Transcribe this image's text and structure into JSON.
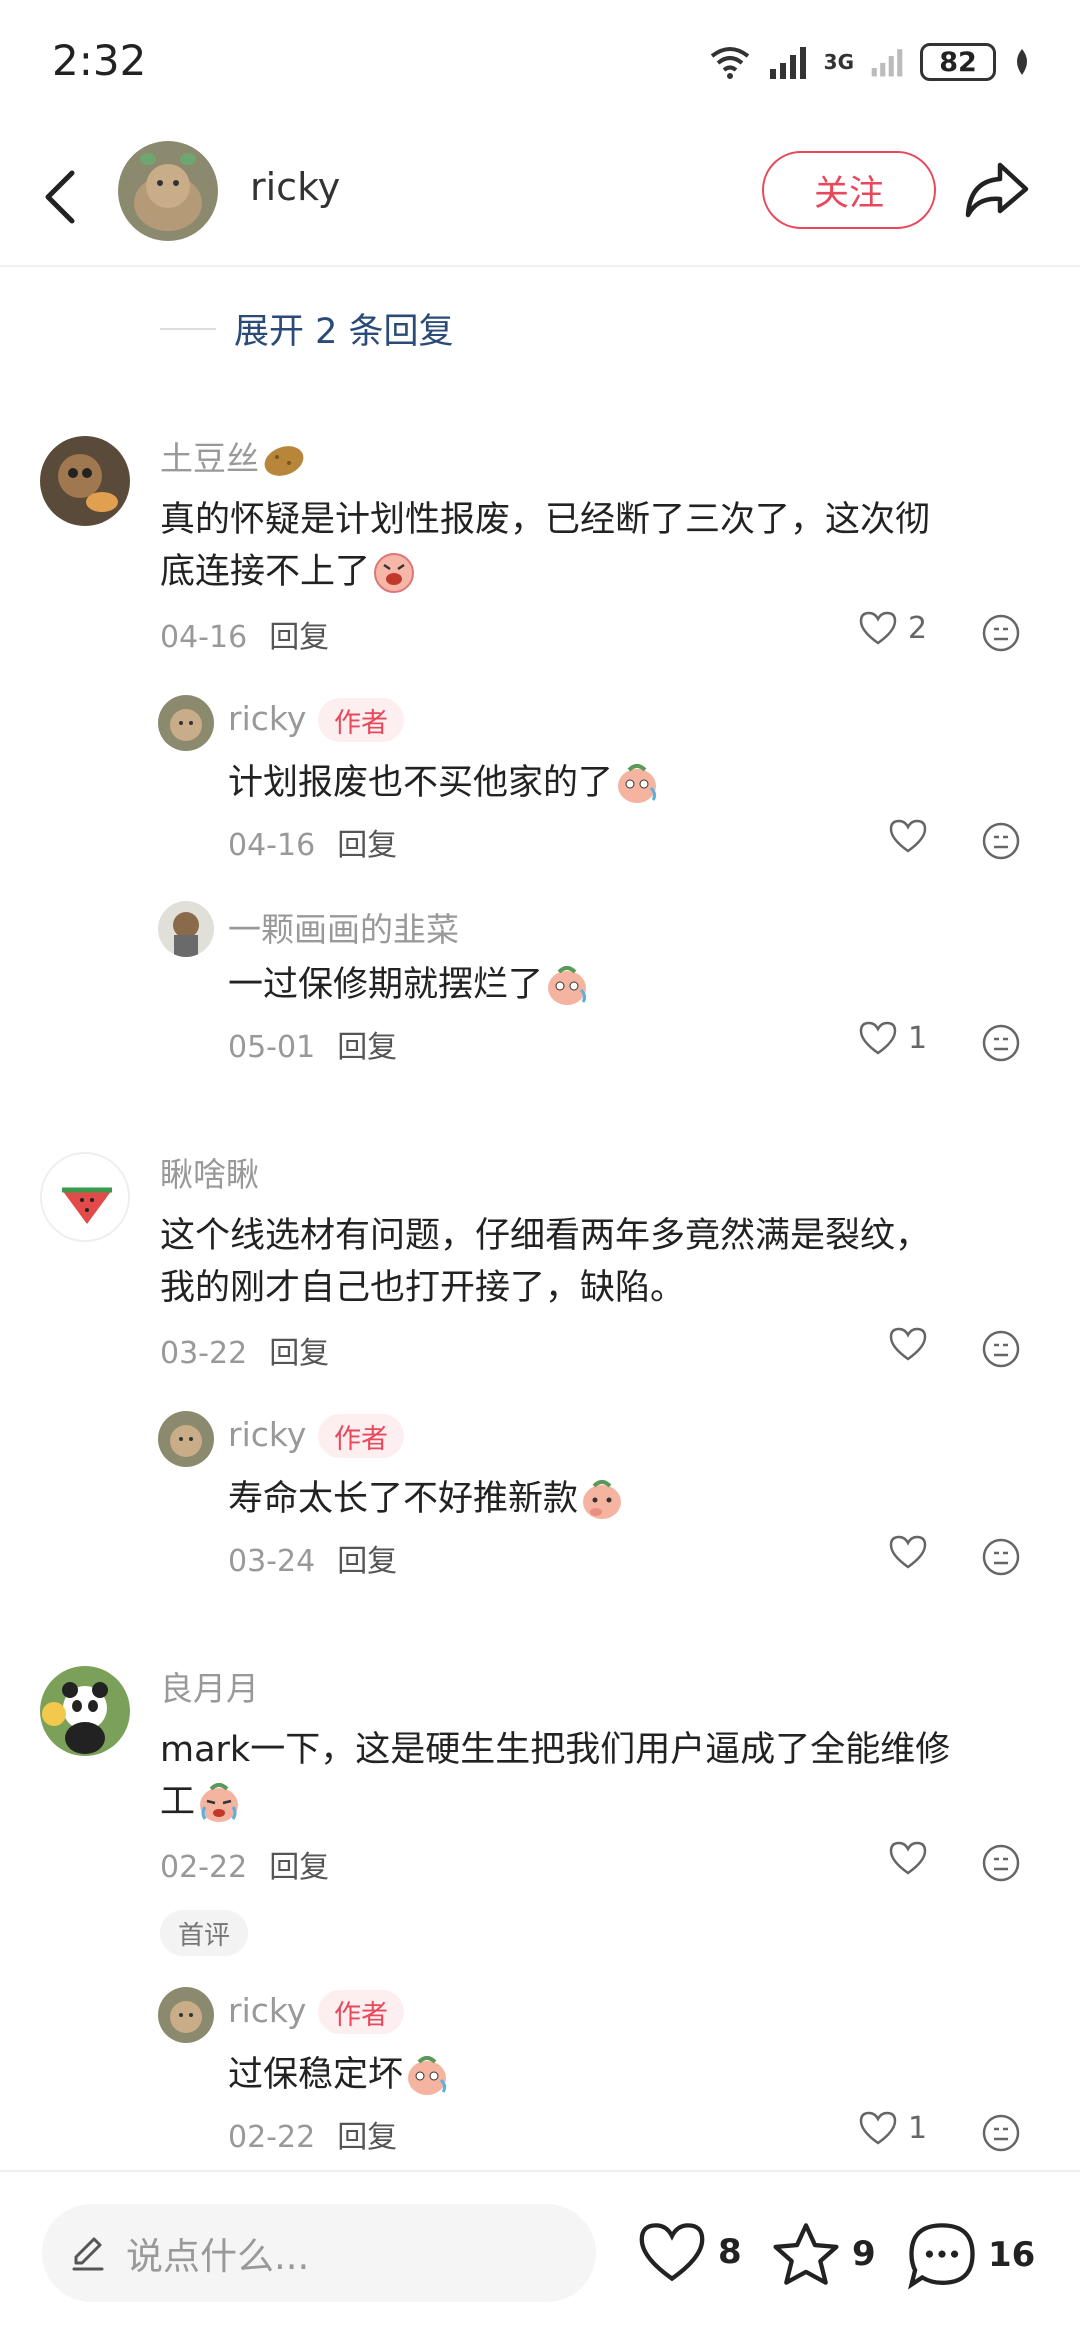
{
  "status_bar": {
    "time": "2:32",
    "network": "3G",
    "battery": "82"
  },
  "header": {
    "author_name": "ricky",
    "follow_label": "关注"
  },
  "expand_replies": "展开 2 条回复",
  "comments": [
    {
      "name": "土豆丝",
      "text_line1": "真的怀疑是计划性报废，已经断了三次了，这次彻",
      "text_line2": "底连接不上了",
      "date": "04-16",
      "reply_label": "回复",
      "likes": "2",
      "replies": [
        {
          "name": "ricky",
          "tag": "作者",
          "text": "计划报废也不买他家的了",
          "date": "04-16",
          "reply_label": "回复",
          "likes": ""
        },
        {
          "name": "一颗画画的韭菜",
          "tag": "",
          "text": "一过保修期就摆烂了",
          "date": "05-01",
          "reply_label": "回复",
          "likes": "1"
        }
      ]
    },
    {
      "name": "瞅啥瞅",
      "text_line1": "这个线选材有问题，仔细看两年多竟然满是裂纹，",
      "text_line2": "我的刚才自己也打开接了，缺陷。",
      "date": "03-22",
      "reply_label": "回复",
      "likes": "",
      "replies": [
        {
          "name": "ricky",
          "tag": "作者",
          "text": "寿命太长了不好推新款",
          "date": "03-24",
          "reply_label": "回复",
          "likes": ""
        }
      ]
    },
    {
      "name": "良月月",
      "text_line1": "mark一下，这是硬生生把我们用户逼成了全能维修",
      "text_line2": "工",
      "date": "02-22",
      "reply_label": "回复",
      "likes": "",
      "badge": "首评",
      "replies": [
        {
          "name": "ricky",
          "tag": "作者",
          "text": "过保稳定坏",
          "date": "02-22",
          "reply_label": "回复",
          "likes": "1"
        }
      ]
    }
  ],
  "bottom_bar": {
    "placeholder": "说点什么...",
    "like_count": "8",
    "star_count": "9",
    "comment_count": "16"
  },
  "colors": {
    "accent": "#e8485c",
    "link": "#2a4a78",
    "muted": "#999999"
  },
  "icons": [
    "back-icon",
    "share-icon",
    "heart-icon",
    "face-icon",
    "pen-icon",
    "star-icon",
    "comment-icon",
    "wifi-icon",
    "signal-icon",
    "battery-icon"
  ]
}
